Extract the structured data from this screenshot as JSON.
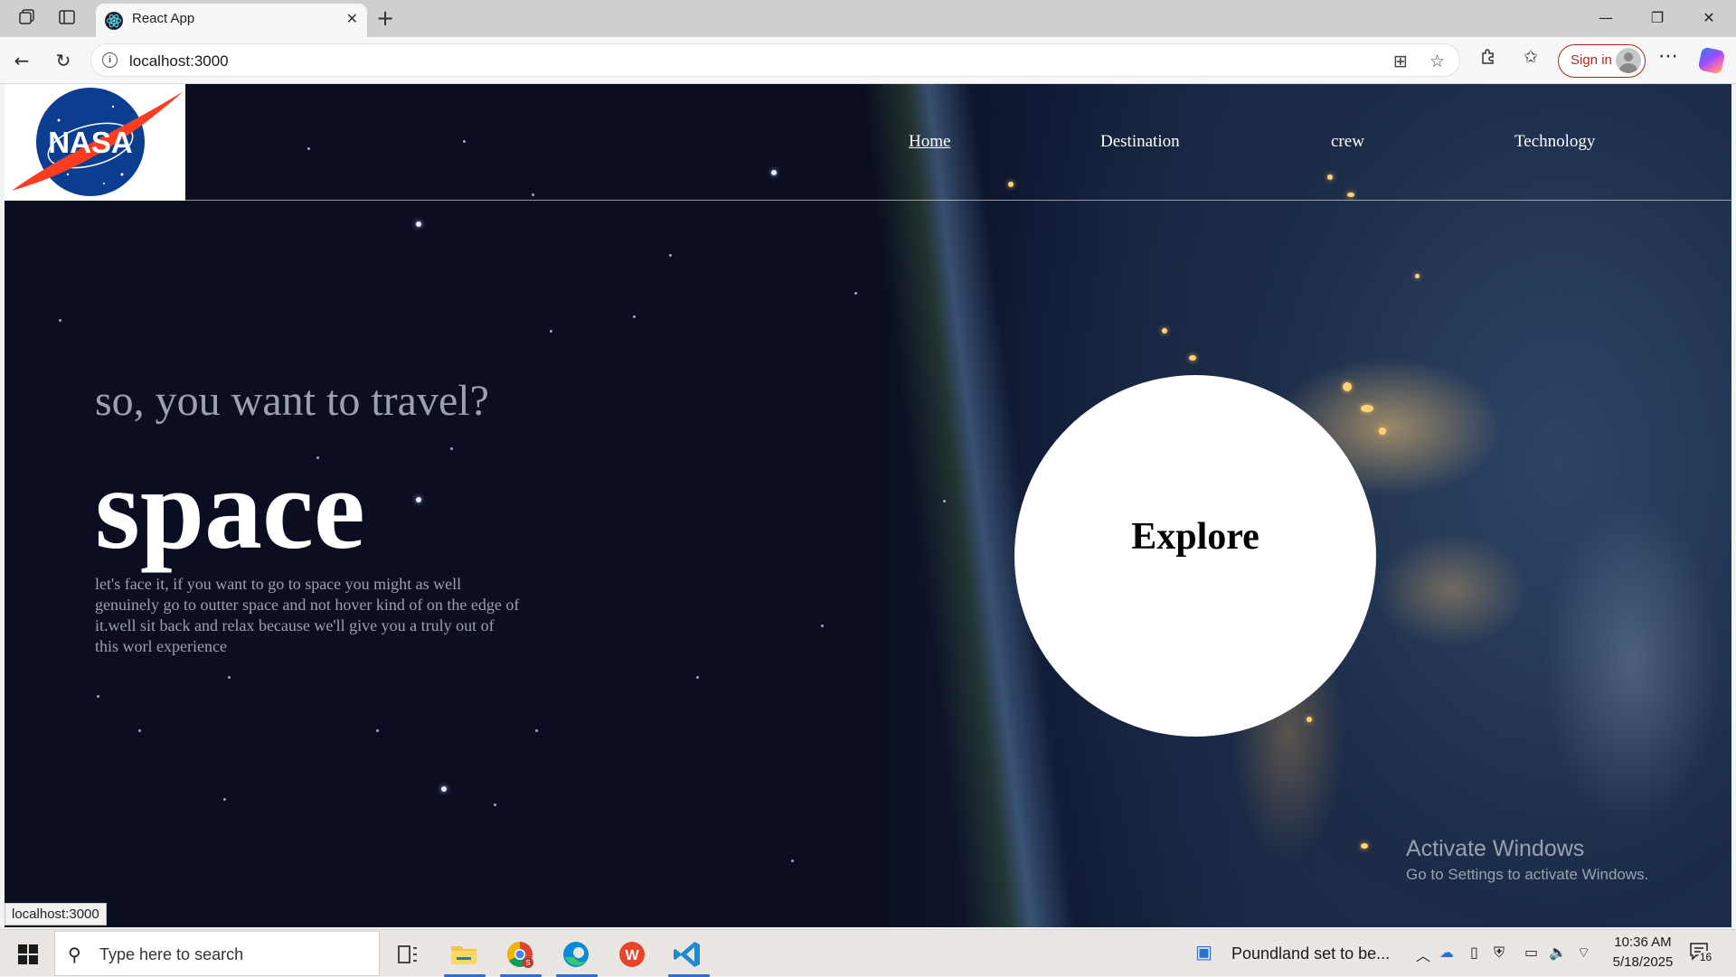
{
  "browser": {
    "tab_title": "React App",
    "url": "localhost:3000",
    "signin_label": "Sign in",
    "status_url": "localhost:3000"
  },
  "site": {
    "logo_text": "NASA",
    "nav": [
      {
        "label": "Home",
        "active": true
      },
      {
        "label": "Destination",
        "active": false
      },
      {
        "label": "crew",
        "active": false
      },
      {
        "label": "Technology",
        "active": false
      }
    ],
    "subtitle": "so, you want to travel?",
    "hero_title": "space",
    "description": "let's face it, if you want to go to space you might as well genuinely go to outter space and not hover kind of on the edge of it.well sit back and relax because we'll give you a truly out of this worl experience",
    "explore_label": "Explore"
  },
  "watermark": {
    "line1": "Activate Windows",
    "line2": "Go to Settings to activate Windows."
  },
  "taskbar": {
    "search_placeholder": "Type here to search",
    "news_text": "Poundland set to be...",
    "time": "10:36 AM",
    "date": "5/18/2025",
    "notification_count": "16"
  }
}
